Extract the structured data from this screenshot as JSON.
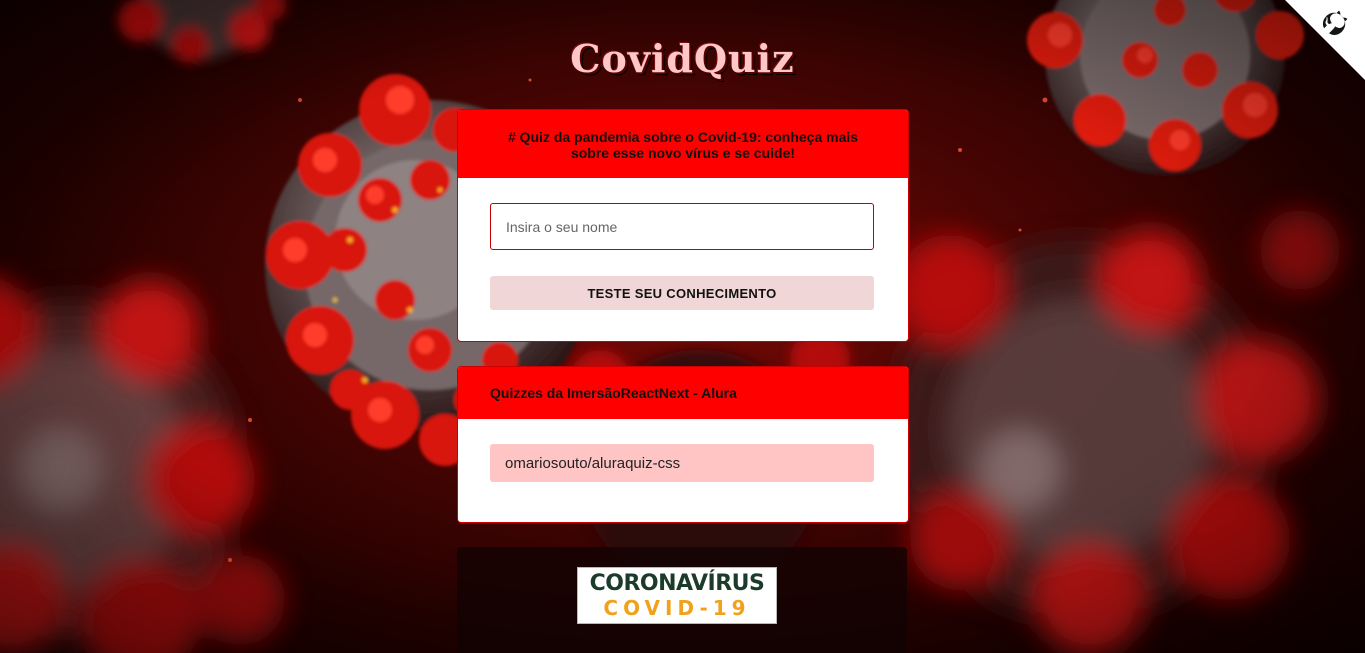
{
  "app": {
    "logo_text": "CovidQuiz"
  },
  "intro_widget": {
    "title": "# Quiz da pandemia sobre o Covid-19: conheça mais sobre esse novo vírus e se cuide!",
    "name_input": {
      "placeholder": "Insira o seu nome",
      "value": ""
    },
    "submit_label": "TESTE SEU CONHECIMENTO"
  },
  "community_widget": {
    "title": "Quizzes da ImersãoReactNext - Alura",
    "links": [
      {
        "label": "omariosouto/aluraquiz-css"
      }
    ]
  },
  "footer_widget": {
    "banner": {
      "line1": "CORONAVÍRUS",
      "line2": "COVID-19"
    }
  },
  "github_corner": {
    "icon": "github-octocat-icon"
  },
  "colors": {
    "header_red": "#ff0000",
    "input_border": "#c40000",
    "button_bg": "#f0d6d6",
    "link_bg": "#ffc4c4",
    "logo_text": "#ffc7c7",
    "banner_green": "#1d3b2a",
    "banner_orange": "#f0a21c"
  }
}
